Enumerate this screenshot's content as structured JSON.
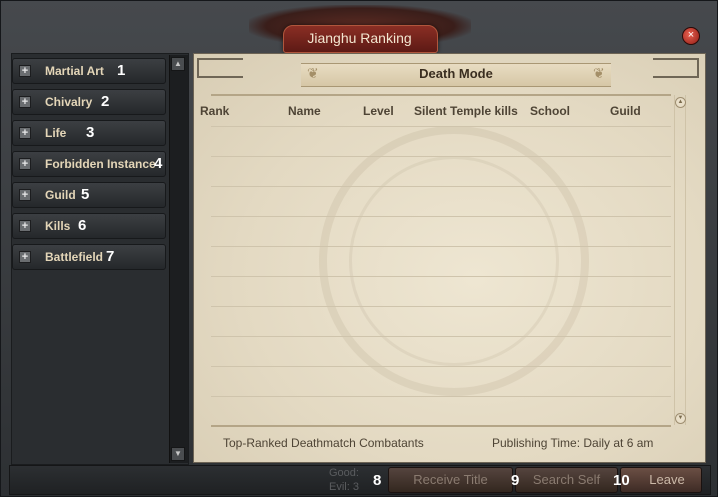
{
  "window": {
    "title": "Jianghu Ranking",
    "close_icon": "×"
  },
  "sidebar": {
    "items": [
      {
        "label": "Martial Art",
        "number": "1"
      },
      {
        "label": "Chivalry",
        "number": "2"
      },
      {
        "label": "Life",
        "number": "3"
      },
      {
        "label": "Forbidden Instance",
        "number": "4"
      },
      {
        "label": "Guild",
        "number": "5"
      },
      {
        "label": "Kills",
        "number": "6"
      },
      {
        "label": "Battlefield",
        "number": "7"
      }
    ],
    "expand_icon": "+"
  },
  "ranking": {
    "mode_title": "Death Mode",
    "columns": [
      "Rank",
      "Name",
      "Level",
      "Silent Temple kills",
      "School",
      "Guild"
    ],
    "rows": [],
    "footer_left": "Top-Ranked Deathmatch Combatants",
    "footer_right": "Publishing Time: Daily at 6 am"
  },
  "status": {
    "good_label": "Good:",
    "evil_label": "Evil: 3"
  },
  "actions": {
    "receive_title": "Receive Title",
    "receive_number": "8",
    "search_self": "Search Self",
    "search_number": "9",
    "leave": "Leave",
    "leave_number": "10"
  },
  "colors": {
    "accent": "#8a2e24",
    "parchment": "#e8dfca"
  }
}
